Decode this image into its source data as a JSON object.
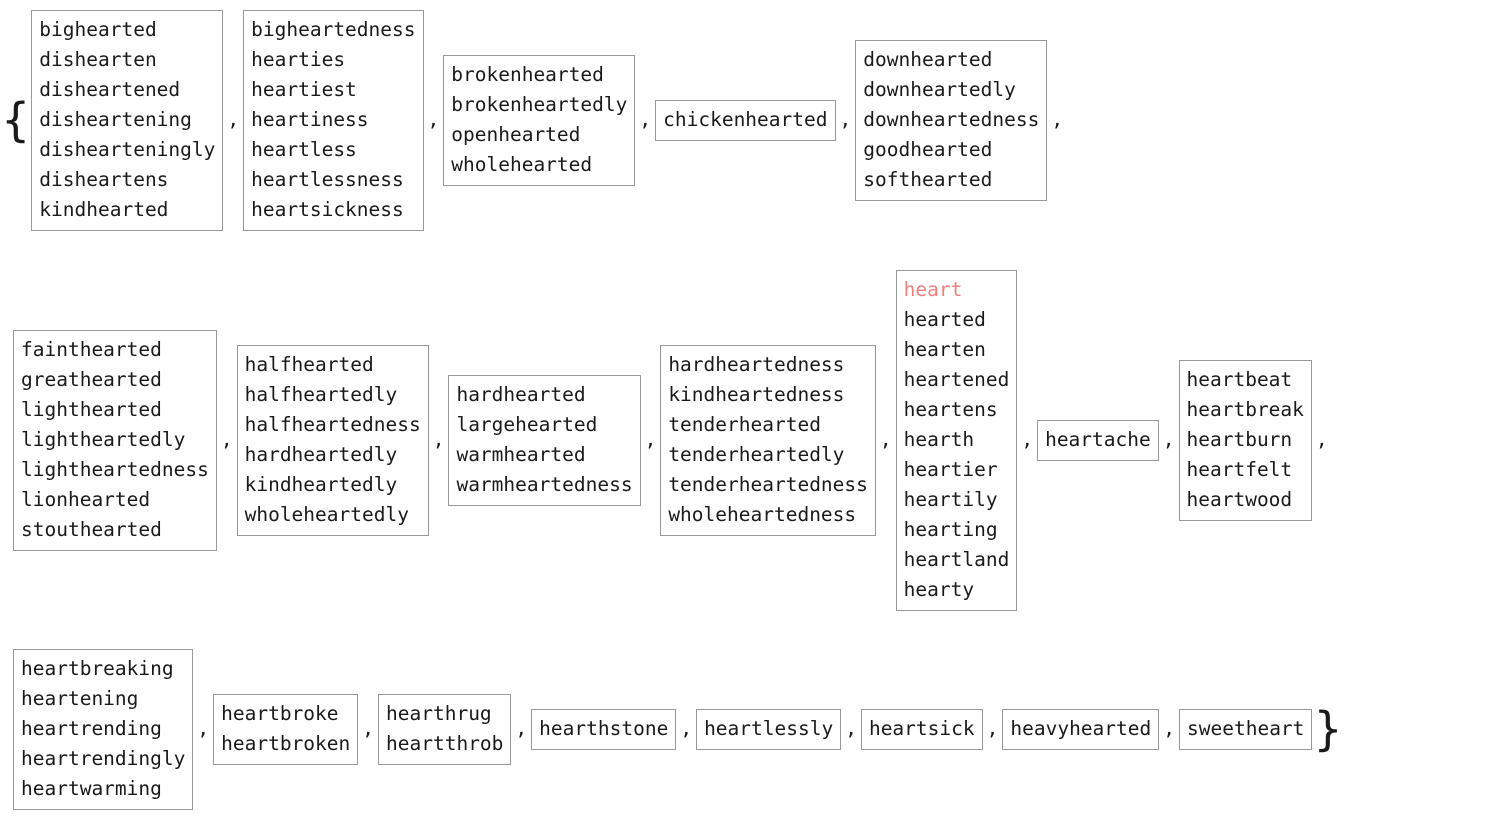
{
  "notation": {
    "open_brace": "{",
    "close_brace": "}",
    "separator": ","
  },
  "highlight_color": "#f08080",
  "border_color": "#999999",
  "highlighted_word": "heart",
  "rows": [
    {
      "index": 0,
      "groups": [
        {
          "words": [
            "bighearted",
            "dishearten",
            "disheartened",
            "disheartening",
            "dishearteningly",
            "disheartens",
            "kindhearted"
          ]
        },
        {
          "words": [
            "bigheartedness",
            "hearties",
            "heartiest",
            "heartiness",
            "heartless",
            "heartlessness",
            "heartsickness"
          ]
        },
        {
          "words": [
            "brokenhearted",
            "brokenheartedly",
            "openhearted",
            "wholehearted"
          ]
        },
        {
          "words": [
            "chickenhearted"
          ]
        },
        {
          "words": [
            "downhearted",
            "downheartedly",
            "downheartedness",
            "goodhearted",
            "softhearted"
          ]
        }
      ]
    },
    {
      "index": 1,
      "groups": [
        {
          "words": [
            "fainthearted",
            "greathearted",
            "lighthearted",
            "lightheartedly",
            "lightheartedness",
            "lionhearted",
            "stouthearted"
          ]
        },
        {
          "words": [
            "halfhearted",
            "halfheartedly",
            "halfheartedness",
            "hardheartedly",
            "kindheartedly",
            "wholeheartedly"
          ]
        },
        {
          "words": [
            "hardhearted",
            "largehearted",
            "warmhearted",
            "warmheartedness"
          ]
        },
        {
          "words": [
            "hardheartedness",
            "kindheartedness",
            "tenderhearted",
            "tenderheartedly",
            "tenderheartedness",
            "wholeheartedness"
          ]
        },
        {
          "words": [
            "heart",
            "hearted",
            "hearten",
            "heartened",
            "heartens",
            "hearth",
            "heartier",
            "heartily",
            "hearting",
            "heartland",
            "hearty"
          ]
        },
        {
          "words": [
            "heartache"
          ]
        },
        {
          "words": [
            "heartbeat",
            "heartbreak",
            "heartburn",
            "heartfelt",
            "heartwood"
          ]
        }
      ]
    },
    {
      "index": 2,
      "groups": [
        {
          "words": [
            "heartbreaking",
            "heartening",
            "heartrending",
            "heartrendingly",
            "heartwarming"
          ]
        },
        {
          "words": [
            "heartbroke",
            "heartbroken"
          ]
        },
        {
          "words": [
            "hearthrug",
            "heartthrob"
          ]
        },
        {
          "words": [
            "hearthstone"
          ]
        },
        {
          "words": [
            "heartlessly"
          ]
        },
        {
          "words": [
            "heartsick"
          ]
        },
        {
          "words": [
            "heavyhearted"
          ]
        },
        {
          "words": [
            "sweetheart"
          ]
        }
      ]
    }
  ]
}
